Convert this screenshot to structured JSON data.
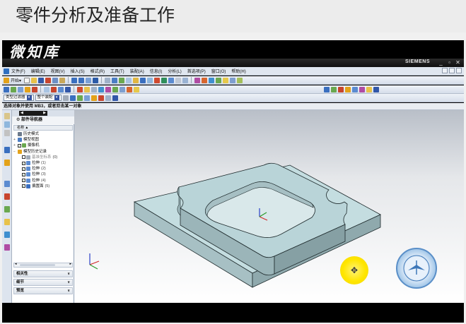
{
  "page_title": "零件分析及准备工作",
  "watermark": "微知库",
  "window": {
    "brand": "SIEMENS",
    "controls": [
      "_",
      "▫",
      "✕"
    ]
  },
  "menu": {
    "app_icon": "nx-icon",
    "items": [
      "文件(F)",
      "编辑(E)",
      "视图(V)",
      "插入(S)",
      "格式(R)",
      "工具(T)",
      "装配(A)",
      "信息(I)",
      "分析(L)",
      "首选项(P)",
      "窗口(O)",
      "帮助(H)"
    ]
  },
  "toolbar1": {
    "start_label": "开始▾"
  },
  "toolbar3": {
    "filter_combo": "类型过滤器",
    "scope_combo": "整个装配"
  },
  "prompt": "选择对象并使用 MB3，或者双击某一对象",
  "navigator": {
    "title": "部件导航器",
    "column_header": "名称 ▲",
    "tree": [
      {
        "label": "历史模式",
        "indent": 0,
        "expander": "",
        "icon": "history-icon",
        "checked": null
      },
      {
        "label": "模型视图",
        "indent": 0,
        "expander": "+",
        "icon": "views-icon",
        "checked": null
      },
      {
        "label": "摄像机",
        "indent": 0,
        "expander": "+",
        "icon": "camera-icon",
        "checked": true
      },
      {
        "label": "模型历史记录",
        "indent": 0,
        "expander": "−",
        "icon": "folder-icon",
        "checked": null
      },
      {
        "label": "基准坐标系",
        "note": "(0)",
        "indent": 1,
        "expander": "",
        "icon": "csys-icon",
        "checked": false,
        "dim": true
      },
      {
        "label": "拉伸",
        "note": "(1)",
        "indent": 1,
        "expander": "",
        "icon": "extrude-icon",
        "checked": true
      },
      {
        "label": "拉伸",
        "note": "(2)",
        "indent": 1,
        "expander": "",
        "icon": "extrude-icon",
        "checked": true
      },
      {
        "label": "拉伸",
        "note": "(3)",
        "indent": 1,
        "expander": "",
        "icon": "extrude-icon",
        "checked": true
      },
      {
        "label": "拉伸",
        "note": "(4)",
        "indent": 1,
        "expander": "",
        "icon": "extrude-icon",
        "checked": true
      },
      {
        "label": "偏置面",
        "note": "(5)",
        "indent": 1,
        "expander": "",
        "icon": "offset-face-icon",
        "checked": true
      }
    ],
    "sections": [
      "相关性",
      "细节",
      "预览"
    ]
  },
  "colors": {
    "part_face_top": "#c4dde0",
    "part_face_side": "#9fb8bc",
    "part_edge": "#1e2a2c",
    "cursor_halo": "#ffe600",
    "background_top": "#b9bfc8"
  }
}
